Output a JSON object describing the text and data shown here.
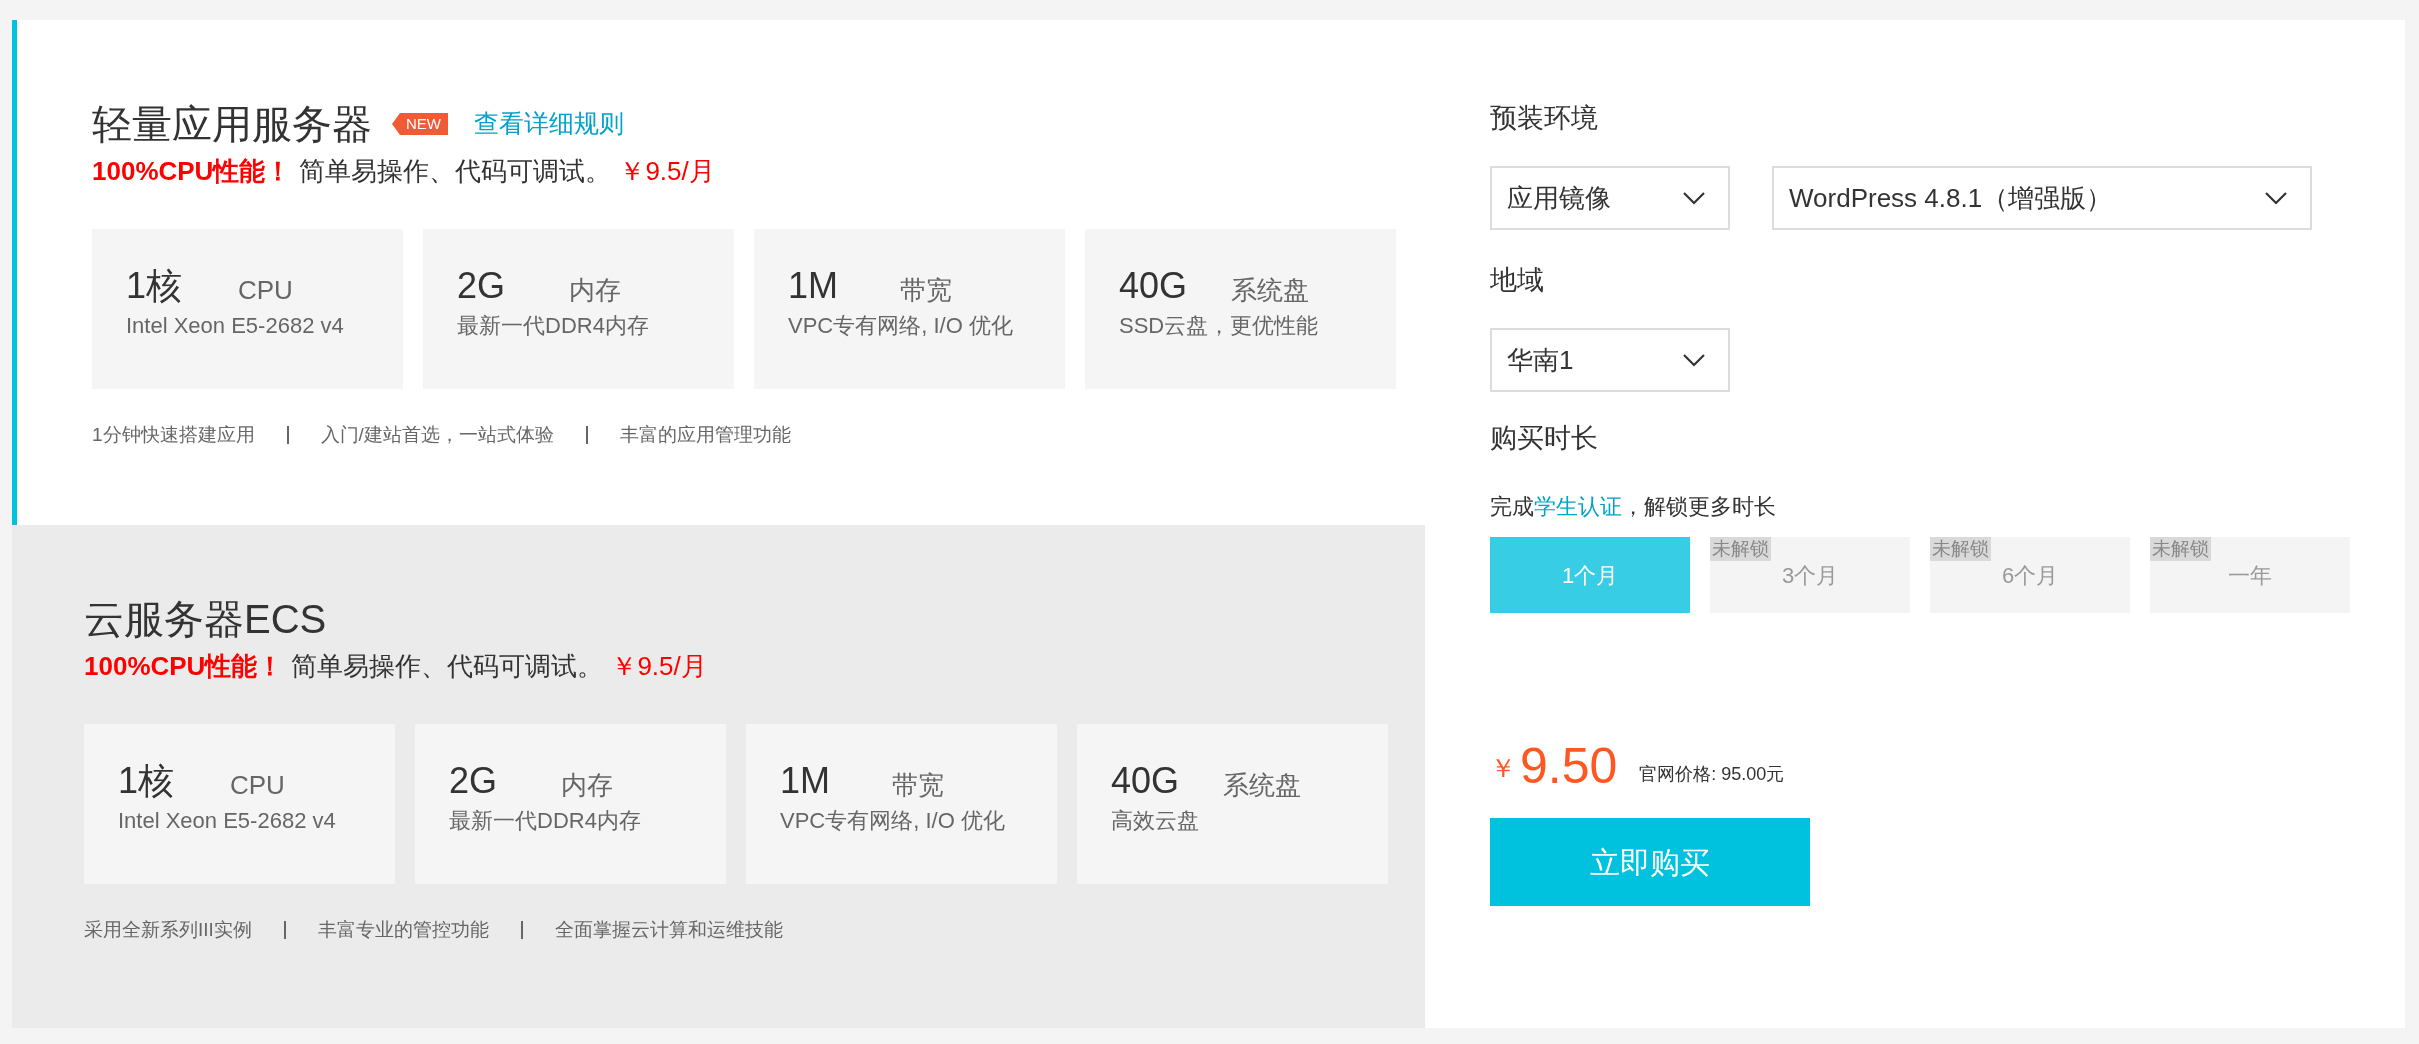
{
  "products": [
    {
      "title": "轻量应用服务器",
      "selected": true,
      "badge": "NEW",
      "link": "查看详细规则",
      "highlight": "100%CPU性能！",
      "description": "简单易操作、代码可调试。",
      "price": "￥9.5/月",
      "specs": [
        {
          "value": "1核",
          "name": "CPU",
          "detail": "Intel Xeon E5-2682 v4"
        },
        {
          "value": "2G",
          "name": "内存",
          "detail": "最新一代DDR4内存"
        },
        {
          "value": "1M",
          "name": "带宽",
          "detail": "VPC专有网络, I/O 优化"
        },
        {
          "value": "40G",
          "name": "系统盘",
          "detail": "SSD云盘，更优性能"
        }
      ],
      "features": [
        "1分钟快速搭建应用",
        "入门/建站首选，一站式体验",
        "丰富的应用管理功能"
      ]
    },
    {
      "title": "云服务器ECS",
      "selected": false,
      "highlight": "100%CPU性能！",
      "description": "简单易操作、代码可调试。",
      "price": "￥9.5/月",
      "specs": [
        {
          "value": "1核",
          "name": "CPU",
          "detail": "Intel Xeon E5-2682 v4"
        },
        {
          "value": "2G",
          "name": "内存",
          "detail": "最新一代DDR4内存"
        },
        {
          "value": "1M",
          "name": "带宽",
          "detail": "VPC专有网络, I/O 优化"
        },
        {
          "value": "40G",
          "name": "系统盘",
          "detail": "高效云盘"
        }
      ],
      "features": [
        "采用全新系列III实例",
        "丰富专业的管控功能",
        "全面掌握云计算和运维技能"
      ]
    }
  ],
  "environment": {
    "label": "预装环境",
    "selects": [
      {
        "value": "应用镜像"
      },
      {
        "value": "WordPress 4.8.1（增强版）"
      }
    ]
  },
  "region": {
    "label": "地域",
    "select": {
      "value": "华南1"
    }
  },
  "duration": {
    "label": "购买时长",
    "notice_before": "完成",
    "notice_link": "学生认证",
    "notice_after": "，解锁更多时长",
    "options": [
      {
        "label": "1个月",
        "selected": true,
        "locked": false
      },
      {
        "label": "3个月",
        "selected": false,
        "locked": true,
        "lock_text": "未解锁"
      },
      {
        "label": "6个月",
        "selected": false,
        "locked": true,
        "lock_text": "未解锁"
      },
      {
        "label": "一年",
        "selected": false,
        "locked": true,
        "lock_text": "未解锁"
      }
    ]
  },
  "price": {
    "currency": "￥",
    "amount": "9.50",
    "list_price": "官网价格: 95.00元"
  },
  "buy_button": "立即购买"
}
